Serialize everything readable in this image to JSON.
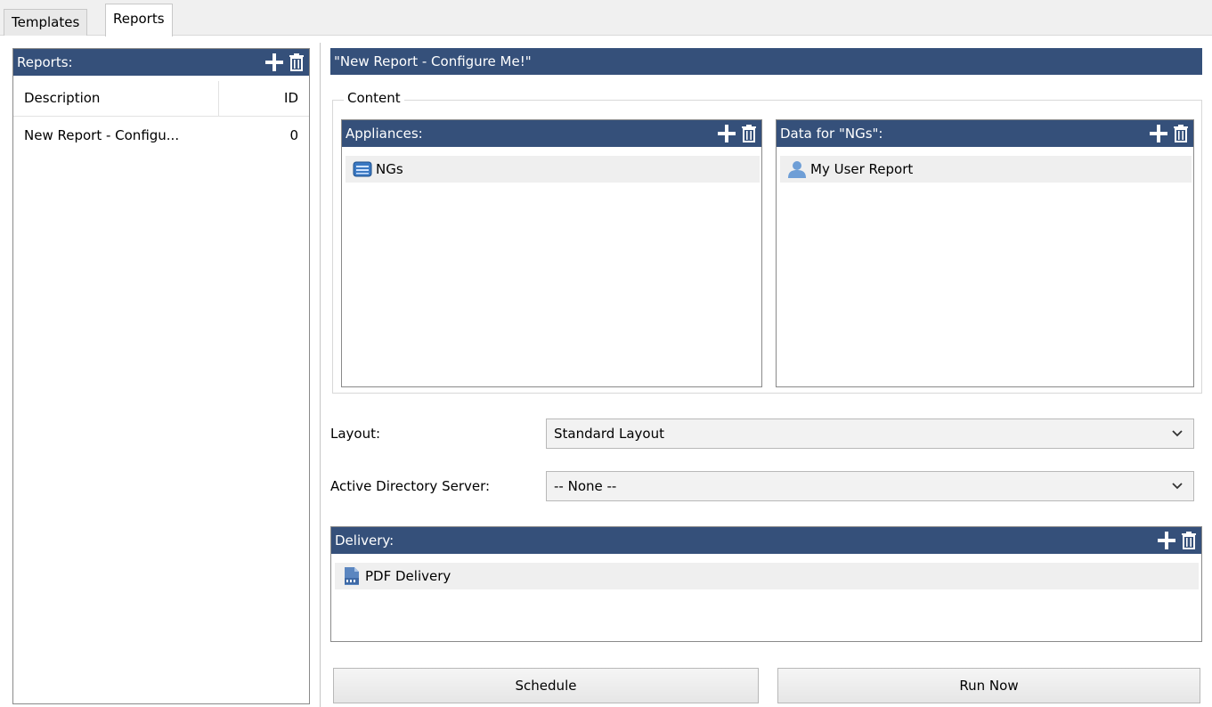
{
  "tabs": [
    {
      "label": "Templates",
      "active": false
    },
    {
      "label": "Reports",
      "active": true
    }
  ],
  "reports_panel": {
    "title": "Reports:",
    "columns": {
      "description": "Description",
      "id": "ID"
    },
    "rows": [
      {
        "description": "New Report - Configu...",
        "id": "0"
      }
    ]
  },
  "report_title": "\"New Report - Configure Me!\"",
  "content": {
    "legend": "Content",
    "appliances": {
      "title": "Appliances:",
      "items": [
        {
          "label": "NGs",
          "icon": "appliance-icon"
        }
      ]
    },
    "data": {
      "title": "Data for \"NGs\":",
      "items": [
        {
          "label": "My User Report",
          "icon": "user-icon"
        }
      ]
    }
  },
  "layout": {
    "label": "Layout:",
    "value": "Standard Layout"
  },
  "ad_server": {
    "label": "Active Directory Server:",
    "value": "-- None --"
  },
  "delivery": {
    "title": "Delivery:",
    "items": [
      {
        "label": "PDF Delivery",
        "icon": "pdf-icon"
      }
    ]
  },
  "buttons": {
    "schedule": "Schedule",
    "run_now": "Run Now"
  },
  "colors": {
    "header_bg": "#35507a",
    "selected_row": "#efefef"
  }
}
